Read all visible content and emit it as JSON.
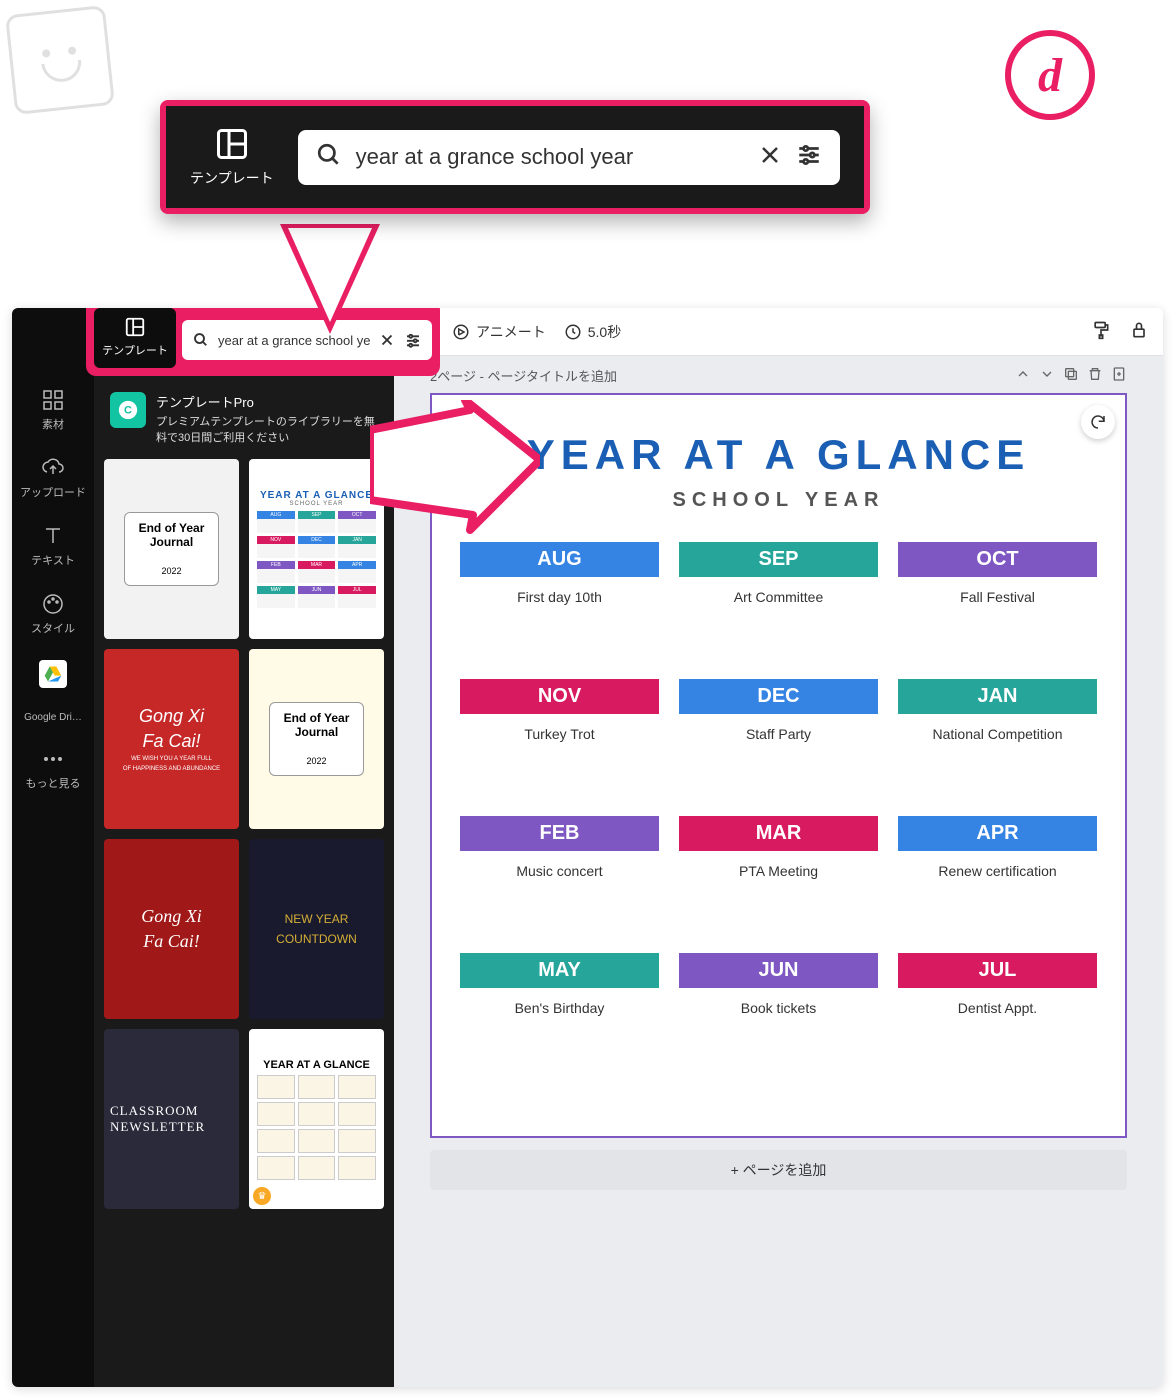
{
  "annotation_letter": "d",
  "callout": {
    "tab_label": "テンプレート",
    "search_text": "year at a grance school year"
  },
  "sidebar_tabs": {
    "template": "テンプレート",
    "elements": "素材",
    "upload": "アップロード",
    "text": "テキスト",
    "style": "スタイル",
    "google_drive": "Google Dri…",
    "more": "もっと見る"
  },
  "template_panel": {
    "search_text": "year at a grance school year",
    "promo_title": "テンプレートPro",
    "promo_sub": "プレミアムテンプレートのライブラリーを無料で30日間ご利用ください",
    "thumbs": {
      "journal1_line1": "End of Year",
      "journal1_line2": "Journal",
      "journal1_year": "2022",
      "yag_title": "YEAR AT A GLANCE",
      "yag_sub": "SCHOOL YEAR",
      "gongxi_line1": "Gong Xi",
      "gongxi_line2": "Fa Cai!",
      "gongxi_sub1": "WE WISH YOU A YEAR FULL",
      "gongxi_sub2": "OF HAPPINESS AND ABUNDANCE",
      "journal2_line1": "End of Year",
      "journal2_line2": "Journal",
      "journal2_year": "2022",
      "countdown_line1": "NEW YEAR",
      "countdown_line2": "COUNTDOWN",
      "newsletter_line1": "CLASSROOM",
      "newsletter_line2": "NEWSLETTER",
      "yag2_title": "YEAR AT A GLANCE"
    }
  },
  "toolbar": {
    "animate": "アニメート",
    "duration": "5.0秒"
  },
  "page_header": {
    "label": "2ページ - ページタイトルを追加"
  },
  "canvas": {
    "title": "YEAR AT A GLANCE",
    "subtitle": "SCHOOL YEAR",
    "months": [
      {
        "name": "AUG",
        "color": "c-blue",
        "event": "First day 10th"
      },
      {
        "name": "SEP",
        "color": "c-teal",
        "event": "Art Committee"
      },
      {
        "name": "OCT",
        "color": "c-purple",
        "event": "Fall Festival"
      },
      {
        "name": "NOV",
        "color": "c-pink",
        "event": "Turkey Trot"
      },
      {
        "name": "DEC",
        "color": "c-blue",
        "event": "Staff Party"
      },
      {
        "name": "JAN",
        "color": "c-teal",
        "event": "National Competition"
      },
      {
        "name": "FEB",
        "color": "c-purple",
        "event": "Music concert"
      },
      {
        "name": "MAR",
        "color": "c-pink",
        "event": "PTA Meeting"
      },
      {
        "name": "APR",
        "color": "c-blue",
        "event": "Renew certification"
      },
      {
        "name": "MAY",
        "color": "c-teal",
        "event": "Ben's Birthday"
      },
      {
        "name": "JUN",
        "color": "c-purple",
        "event": "Book tickets"
      },
      {
        "name": "JUL",
        "color": "c-pink",
        "event": "Dentist Appt."
      }
    ]
  },
  "add_page_label": "+ ページを追加",
  "mini_months": [
    "AUG",
    "SEP",
    "OCT",
    "NOV",
    "DEC",
    "JAN",
    "FEB",
    "MAR",
    "APR",
    "MAY",
    "JUN",
    "JUL"
  ],
  "mini_colors": [
    "c-blue",
    "c-teal",
    "c-purple",
    "c-pink",
    "c-blue",
    "c-teal",
    "c-purple",
    "c-pink",
    "c-blue",
    "c-teal",
    "c-purple",
    "c-pink"
  ]
}
